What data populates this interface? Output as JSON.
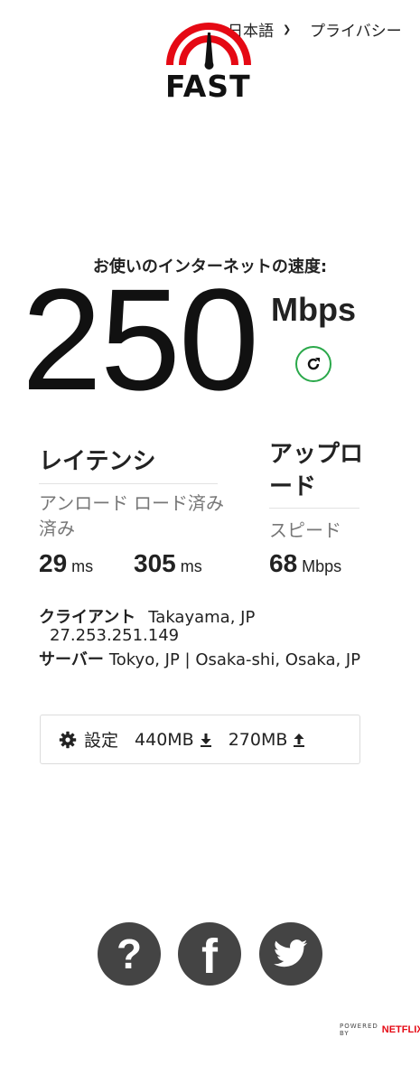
{
  "header": {
    "language_label": "日本語",
    "privacy_label": "プライバシー"
  },
  "logo": {
    "text": "FAST",
    "colors": {
      "arc": "#e50914",
      "needle": "#111111"
    }
  },
  "speed": {
    "label": "お使いのインターネットの速度:",
    "value": "250",
    "unit": "Mbps",
    "refresh_icon": "refresh-icon"
  },
  "latency": {
    "title": "レイテンシ",
    "unloaded_label": "アンロード済み",
    "unloaded_value": "29",
    "unloaded_unit": "ms",
    "loaded_label": "ロード済み",
    "loaded_value": "305",
    "loaded_unit": "ms"
  },
  "upload": {
    "title": "アップロード",
    "speed_label": "スピード",
    "value": "68",
    "unit": "Mbps"
  },
  "info": {
    "client_label": "クライアント",
    "client_location": "Takayama, JP",
    "client_ip": "27.253.251.149",
    "server_label": "サーバー",
    "server_locations": "Tokyo, JP | Osaka-shi, Osaka, JP"
  },
  "settings": {
    "label": "設定",
    "download_size": "440MB",
    "upload_size": "270MB"
  },
  "social": {
    "help_glyph": "?",
    "facebook_glyph": "f",
    "icons": [
      "help-icon",
      "facebook-icon",
      "twitter-icon"
    ]
  },
  "footer": {
    "powered_by": "POWERED BY",
    "brand": "NETFLIX"
  },
  "colors": {
    "accent_green": "#2aa84a",
    "netflix_red": "#e50914",
    "social_bg": "#444444"
  }
}
